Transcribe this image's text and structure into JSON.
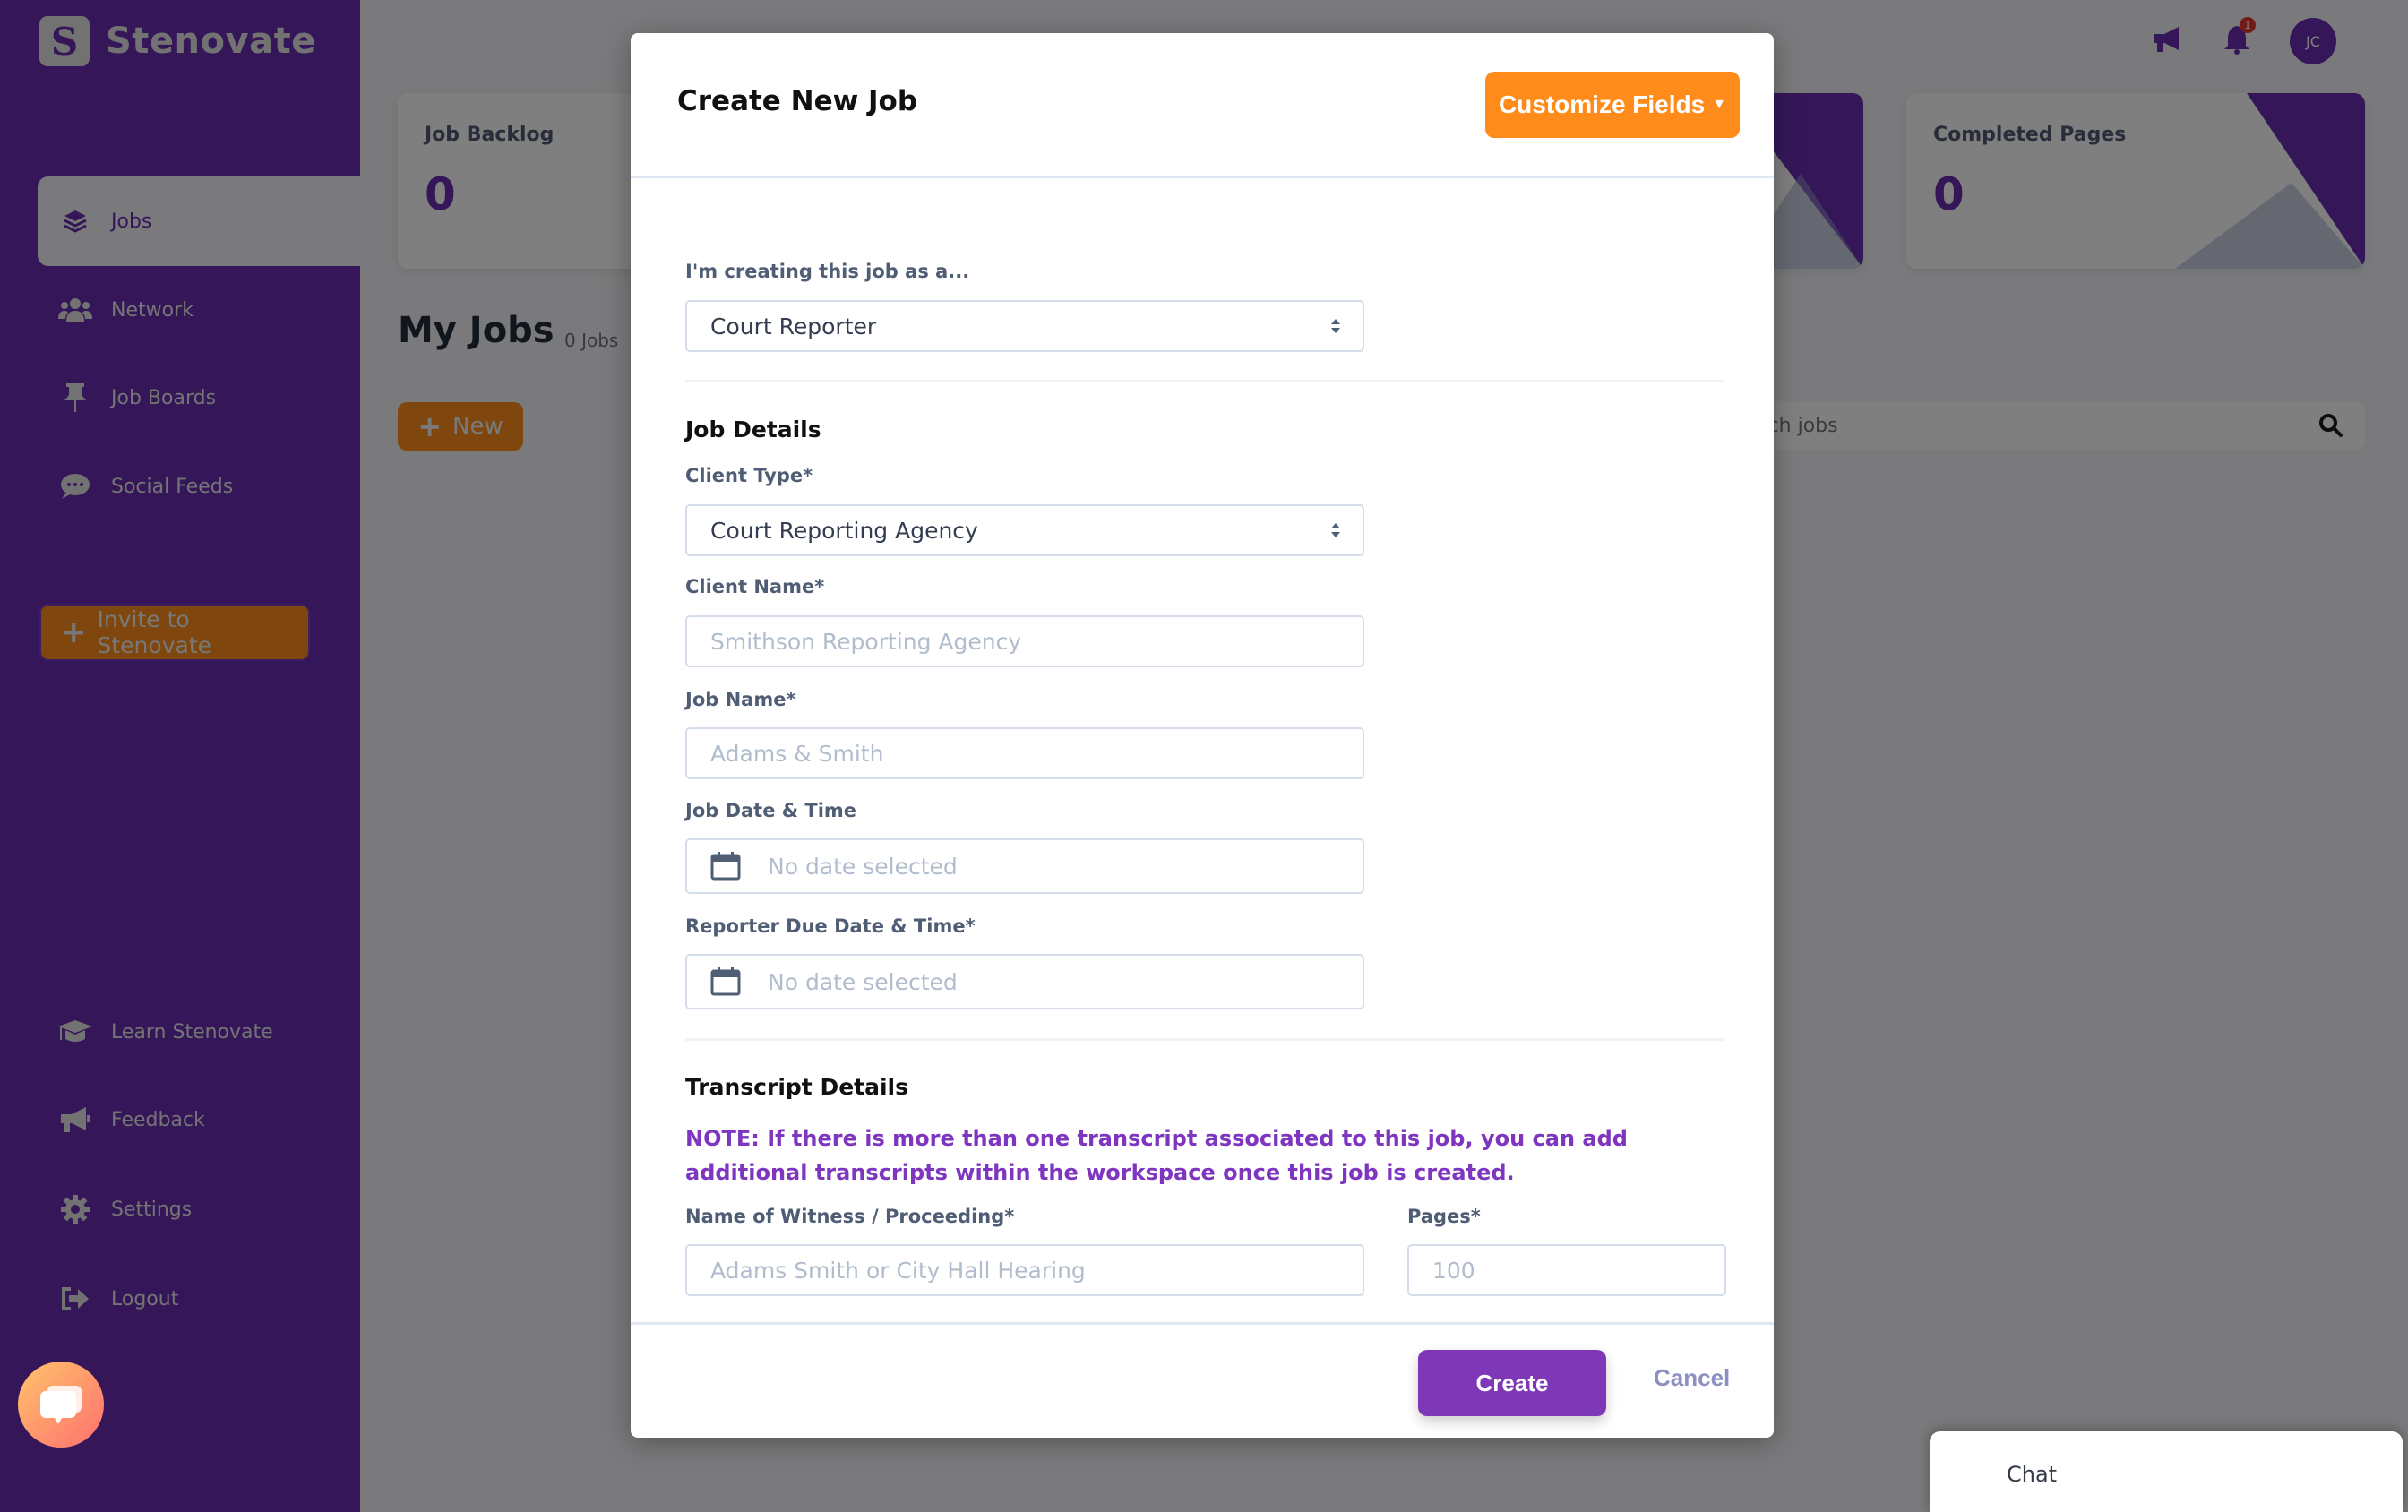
{
  "app": {
    "brand_name": "Stenovate",
    "brand_logo_letter": "S"
  },
  "sidebar": {
    "items": [
      {
        "label": "Jobs",
        "icon": "layers-icon",
        "active": true
      },
      {
        "label": "Network",
        "icon": "users-icon",
        "active": false
      },
      {
        "label": "Job Boards",
        "icon": "thumbtack-icon",
        "active": false
      },
      {
        "label": "Social Feeds",
        "icon": "comment-dots-icon",
        "active": false
      }
    ],
    "invite_label": "Invite to Stenovate",
    "bottom_items": [
      {
        "label": "Learn Stenovate",
        "icon": "graduation-cap-icon"
      },
      {
        "label": "Feedback",
        "icon": "bullhorn-icon"
      },
      {
        "label": "Settings",
        "icon": "gear-icon"
      },
      {
        "label": "Logout",
        "icon": "sign-out-icon"
      }
    ]
  },
  "topbar": {
    "notification_count": "1",
    "avatar_initials": "JC"
  },
  "stats": [
    {
      "label": "Job Backlog",
      "value": "0"
    },
    {
      "label": "Completed Pages",
      "value": "0"
    }
  ],
  "main": {
    "title": "My Jobs",
    "job_count": "0 Jobs",
    "new_label": "New",
    "search_placeholder": "Search jobs"
  },
  "modal": {
    "title": "Create New Job",
    "customize_label": "Customize Fields",
    "role_label": "I'm creating this job as a...",
    "role_value": "Court Reporter",
    "job_details_title": "Job Details",
    "client_type_label": "Client Type*",
    "client_type_value": "Court Reporting Agency",
    "client_name_label": "Client Name*",
    "client_name_placeholder": "Smithson Reporting Agency",
    "job_name_label": "Job Name*",
    "job_name_placeholder": "Adams & Smith",
    "job_date_label": "Job Date & Time",
    "job_date_placeholder": "No date selected",
    "due_date_label": "Reporter Due Date & Time*",
    "due_date_placeholder": "No date selected",
    "transcript_title": "Transcript Details",
    "note": "NOTE: If there is more than one transcript associated to this job, you can add additional transcripts within the workspace once this job is created.",
    "witness_label": "Name of Witness / Proceeding*",
    "witness_placeholder": "Adams Smith or City Hall Hearing",
    "pages_label": "Pages*",
    "pages_placeholder": "100",
    "create_label": "Create",
    "cancel_label": "Cancel"
  },
  "chat": {
    "label": "Chat"
  },
  "colors": {
    "brand_purple": "#6a2fb3",
    "accent_orange": "#ff8c1a",
    "create_purple": "#7e38b7",
    "note_purple": "#7e35bf"
  }
}
